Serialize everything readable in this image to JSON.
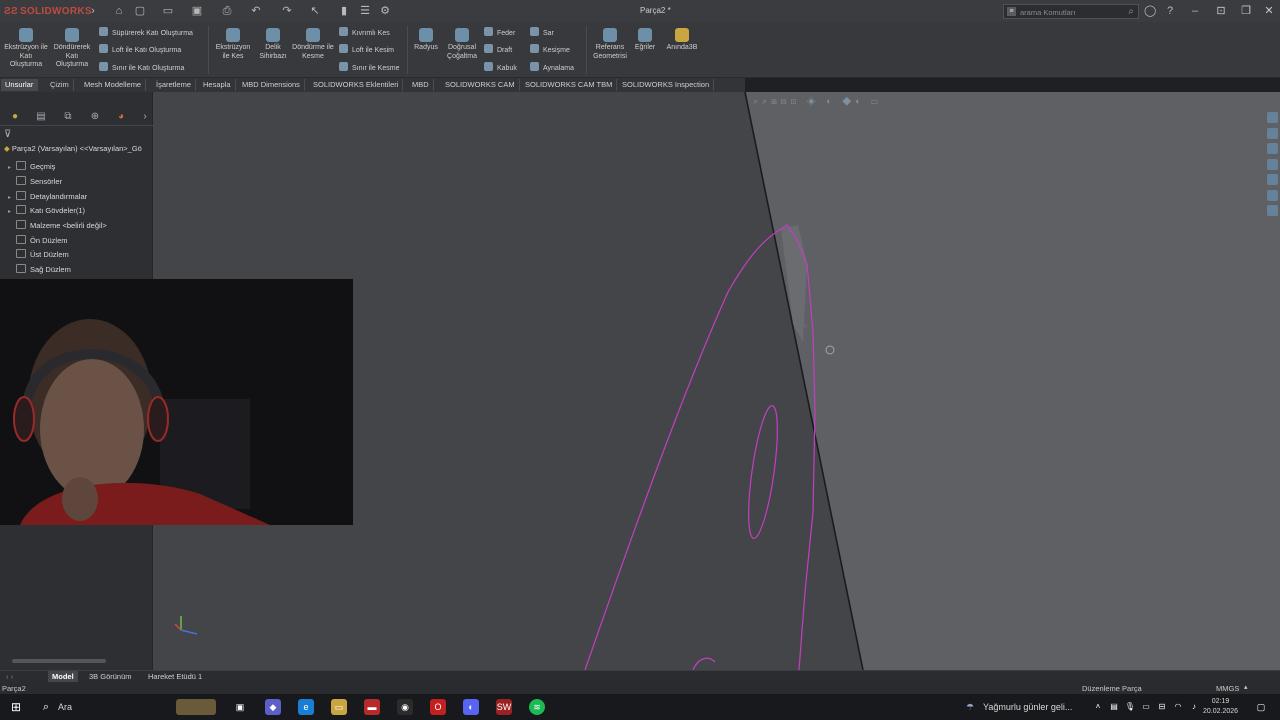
{
  "titlebar": {
    "app_name": "SOLIDWORKS",
    "document_title": "Parça2 *",
    "search_placeholder": "arama Komutları"
  },
  "ribbon": {
    "extrude_boss": "Ekstrüzyon ile Katı Oluşturma",
    "revolve_boss": "Döndürerek Katı Oluşturma",
    "swept_boss": "Süpürerek Katı Oluşturma",
    "loft_boss": "Loft ile Katı Oluşturma",
    "boundary_boss": "Sınır ile Katı Oluşturma",
    "extrude_cut": "Ekstrüzyon ile Kes",
    "hole_wizard": "Delik Sihirbazı",
    "revolve_cut": "Döndürme ile Kesme",
    "swept_cut": "Kıvrımlı Kes",
    "loft_cut": "Loft ile Kesim",
    "boundary_cut": "Sınır ile Kesme",
    "fillet": "Radyus",
    "linear_pattern": "Doğrusal Çoğaltma",
    "rib": "Feder",
    "draft": "Draft",
    "shell": "Kabuk",
    "wrap": "Sar",
    "intersect": "Kesişme",
    "mirror": "Aynalama",
    "ref_geometry": "Referans Geometrisi",
    "curves": "Eğriler",
    "instant3d": "Anında3B"
  },
  "tabs": [
    "Unsurlar",
    "Çizim",
    "Mesh Modelleme",
    "İşaretleme",
    "Hesapla",
    "MBD Dimensions",
    "SOLIDWORKS Eklentileri",
    "MBD",
    "SOLIDWORKS CAM",
    "SOLIDWORKS CAM TBM",
    "SOLIDWORKS Inspection"
  ],
  "tree": {
    "root": "Parça2 (Varsayılan) <<Varsayılan>_Gö",
    "items": [
      "Geçmiş",
      "Sensörler",
      "Detaylandırmalar",
      "Katı Gövdeler(1)",
      "Malzeme <belirli değil>",
      "Ön Düzlem",
      "Üst Düzlem",
      "Sağ Düzlem"
    ]
  },
  "bottom_tabs": [
    "Model",
    "3B Görünüm",
    "Hareket Etüdü 1"
  ],
  "status": {
    "left": "Parça2",
    "mode": "Düzenleme Parça",
    "units": "MMGS"
  },
  "taskbar": {
    "search": "Ara",
    "weather": "Yağmurlu günler geli...",
    "time": "02:19",
    "date": "20.02.2026"
  },
  "colors": {
    "sketch": "#c23fc2",
    "accent": "#c04a3e"
  }
}
